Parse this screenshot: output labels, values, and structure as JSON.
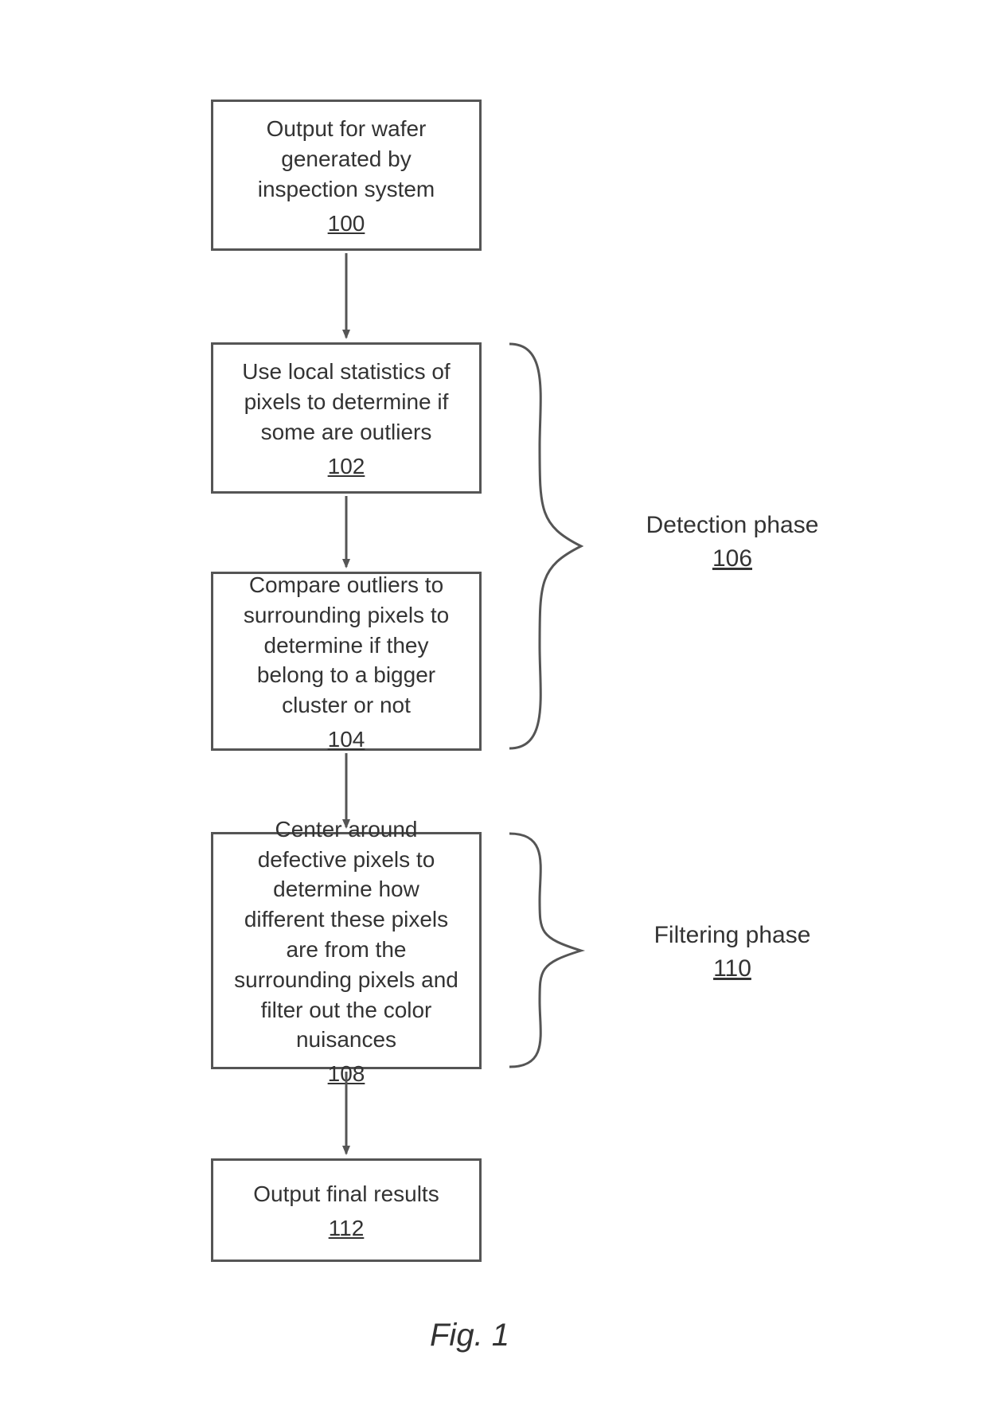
{
  "boxes": {
    "b100": {
      "text": "Output for wafer generated by inspection system",
      "ref": "100"
    },
    "b102": {
      "text": "Use local statistics of pixels to determine if some are outliers",
      "ref": "102"
    },
    "b104": {
      "text": "Compare outliers to surrounding pixels to determine if they belong to a bigger cluster or not",
      "ref": "104"
    },
    "b108": {
      "text": "Center around defective pixels to determine how different these pixels are from the surrounding pixels and filter out the color nuisances",
      "ref": "108"
    },
    "b112": {
      "text": "Output final results",
      "ref": "112"
    }
  },
  "labels": {
    "l106": {
      "text": "Detection phase",
      "ref": "106"
    },
    "l110": {
      "text": "Filtering phase",
      "ref": "110"
    }
  },
  "figure_caption": "Fig. 1"
}
